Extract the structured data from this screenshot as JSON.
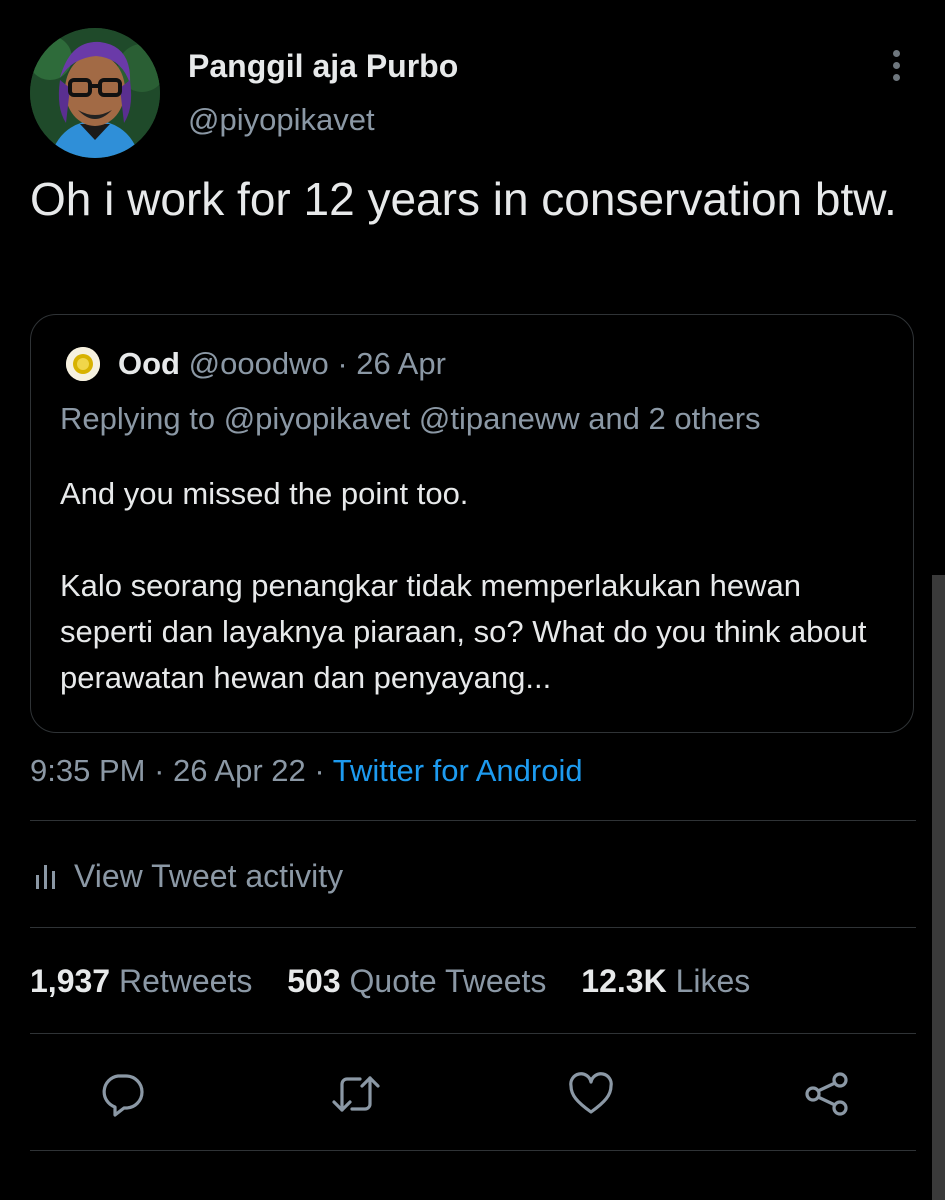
{
  "author": {
    "name": "Panggil aja Purbo",
    "handle": "@piyopikavet"
  },
  "tweet": {
    "text": "Oh i work for 12 years in conservation btw."
  },
  "quoted_tweet": {
    "name": "Ood",
    "handle": "@ooodwo",
    "separator": "·",
    "date": "26 Apr",
    "replying_to": "Replying to @piyopikavet @tipaneww and 2 others",
    "paragraph1": "And you missed the point too.",
    "paragraph2": "Kalo seorang penangkar tidak memperlakukan hewan seperti dan layaknya piaraan, so? What do you think about perawatan hewan dan penyayang..."
  },
  "meta": {
    "time": "9:35 PM",
    "separator": "·",
    "date": "26 Apr 22",
    "client": "Twitter for Android"
  },
  "activity": {
    "label": "View Tweet activity",
    "icon": "bar-chart-icon"
  },
  "stats": {
    "retweets_count": "1,937",
    "retweets_label": "Retweets",
    "quotes_count": "503",
    "quotes_label": "Quote Tweets",
    "likes_count": "12.3K",
    "likes_label": "Likes"
  },
  "actions": {
    "reply_icon": "reply-icon",
    "retweet_icon": "retweet-icon",
    "like_icon": "heart-icon",
    "share_icon": "share-icon"
  },
  "colors": {
    "background": "#000000",
    "text": "#e7e9ea",
    "secondary": "#8b98a5",
    "link": "#1d9bf0",
    "border": "#2f3336"
  }
}
